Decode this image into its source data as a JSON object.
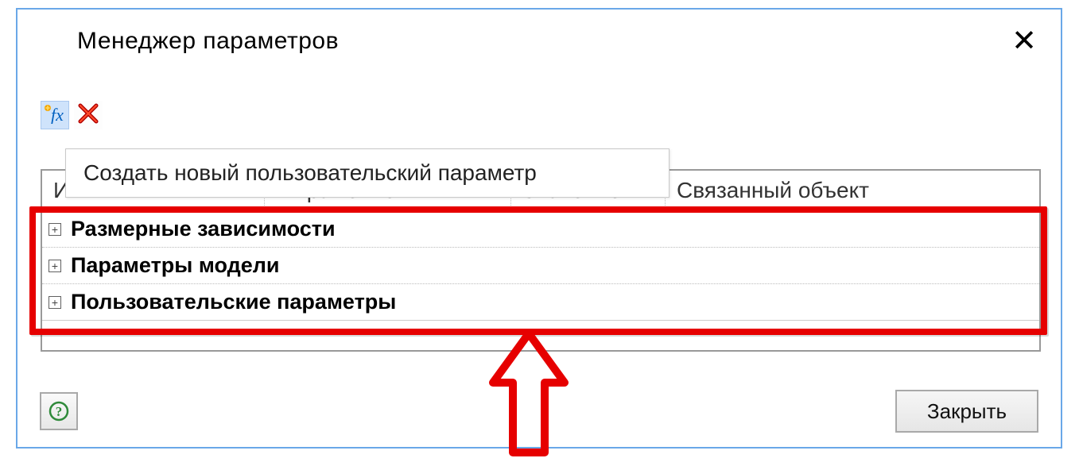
{
  "dialog": {
    "title": "Менеджер параметров",
    "close_button": "Закрыть"
  },
  "toolbar": {
    "fx_icon_name": "fx-icon",
    "delete_icon_name": "delete-x-icon",
    "fx_tooltip": "Создать новый пользовательский параметр"
  },
  "columns": {
    "name": "Имя",
    "expr": "Выражение",
    "value": "Значение",
    "obj": "Связанный объект"
  },
  "groups": [
    {
      "label": "Размерные зависимости"
    },
    {
      "label": "Параметры модели"
    },
    {
      "label": "Пользовательские параметры"
    }
  ],
  "annotation": {
    "highlight_color": "#e60000",
    "arrow_direction": "up"
  }
}
